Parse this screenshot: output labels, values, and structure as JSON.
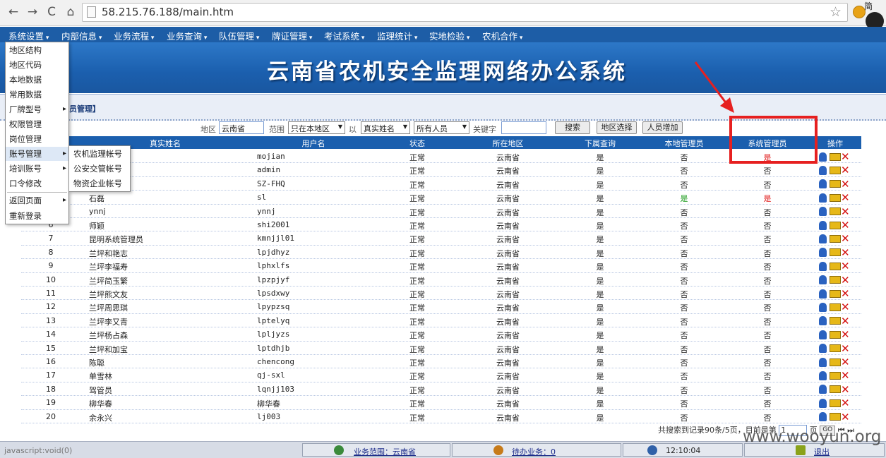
{
  "browser": {
    "url": "58.215.76.188/main.htm",
    "corner_text": "简"
  },
  "menubar": [
    "系统设置",
    "内部信息",
    "业务流程",
    "业务查询",
    "队伍管理",
    "牌证管理",
    "考试系统",
    "监理统计",
    "实地检验",
    "农机合作"
  ],
  "banner_title": "云南省农机安全监理网络办公系统",
  "breadcrumb": "员管理】",
  "filter": {
    "area_label": "地区",
    "area_value": "云南省",
    "scope_label": "范围",
    "scope_value": "只在本地区",
    "by_label": "以",
    "by_value": "真实姓名",
    "people_value": "所有人员",
    "keyword_label": "关键字",
    "search_button": "搜索",
    "area_select_button": "地区选择",
    "add_button": "人员增加"
  },
  "table": {
    "headers": [
      "真实姓名",
      "用户名",
      "状态",
      "所在地区",
      "下属查询",
      "本地管理员",
      "系统管理员",
      "操作"
    ],
    "rows": [
      {
        "no": "",
        "name": "",
        "user": "mojian",
        "status": "正常",
        "area": "云南省",
        "sub": "是",
        "local": "否",
        "sys": "是"
      },
      {
        "no": "",
        "name": "",
        "user": "admin",
        "status": "正常",
        "area": "云南省",
        "sub": "是",
        "local": "否",
        "sys": "否"
      },
      {
        "no": "",
        "name": "",
        "user": "SZ-FHQ",
        "status": "正常",
        "area": "云南省",
        "sub": "是",
        "local": "否",
        "sys": "否"
      },
      {
        "no": "",
        "name": "石磊",
        "user": "sl",
        "status": "正常",
        "area": "云南省",
        "sub": "是",
        "local": "是",
        "sys": "是"
      },
      {
        "no": "",
        "name": "ynnj",
        "user": "ynnj",
        "status": "正常",
        "area": "云南省",
        "sub": "是",
        "local": "否",
        "sys": "否"
      },
      {
        "no": "6",
        "name": "师颖",
        "user": "shi2001",
        "status": "正常",
        "area": "云南省",
        "sub": "是",
        "local": "否",
        "sys": "否"
      },
      {
        "no": "7",
        "name": "昆明系统管理员",
        "user": "kmnjjl01",
        "status": "正常",
        "area": "云南省",
        "sub": "是",
        "local": "否",
        "sys": "否"
      },
      {
        "no": "8",
        "name": "兰坪和艳志",
        "user": "lpjdhyz",
        "status": "正常",
        "area": "云南省",
        "sub": "是",
        "local": "否",
        "sys": "否"
      },
      {
        "no": "9",
        "name": "兰坪李福寿",
        "user": "lphxlfs",
        "status": "正常",
        "area": "云南省",
        "sub": "是",
        "local": "否",
        "sys": "否"
      },
      {
        "no": "10",
        "name": "兰坪简玉繁",
        "user": "lpzpjyf",
        "status": "正常",
        "area": "云南省",
        "sub": "是",
        "local": "否",
        "sys": "否"
      },
      {
        "no": "11",
        "name": "兰坪熊文友",
        "user": "lpsdxwy",
        "status": "正常",
        "area": "云南省",
        "sub": "是",
        "local": "否",
        "sys": "否"
      },
      {
        "no": "12",
        "name": "兰坪周思琪",
        "user": "lpypzsq",
        "status": "正常",
        "area": "云南省",
        "sub": "是",
        "local": "否",
        "sys": "否"
      },
      {
        "no": "13",
        "name": "兰坪李又青",
        "user": "lptelyq",
        "status": "正常",
        "area": "云南省",
        "sub": "是",
        "local": "否",
        "sys": "否"
      },
      {
        "no": "14",
        "name": "兰坪杨占森",
        "user": "lpljyzs",
        "status": "正常",
        "area": "云南省",
        "sub": "是",
        "local": "否",
        "sys": "否"
      },
      {
        "no": "15",
        "name": "兰坪和加宝",
        "user": "lptdhjb",
        "status": "正常",
        "area": "云南省",
        "sub": "是",
        "local": "否",
        "sys": "否"
      },
      {
        "no": "16",
        "name": "陈聪",
        "user": "chencong",
        "status": "正常",
        "area": "云南省",
        "sub": "是",
        "local": "否",
        "sys": "否"
      },
      {
        "no": "17",
        "name": "单雪林",
        "user": "qj-sxl",
        "status": "正常",
        "area": "云南省",
        "sub": "是",
        "local": "否",
        "sys": "否"
      },
      {
        "no": "18",
        "name": "驾管员",
        "user": "lqnjj103",
        "status": "正常",
        "area": "云南省",
        "sub": "是",
        "local": "否",
        "sys": "否"
      },
      {
        "no": "19",
        "name": "柳华春",
        "user": "柳华春",
        "status": "正常",
        "area": "云南省",
        "sub": "是",
        "local": "否",
        "sys": "否"
      },
      {
        "no": "20",
        "name": "余永兴",
        "user": "lj003",
        "status": "正常",
        "area": "云南省",
        "sub": "是",
        "local": "否",
        "sys": "否"
      }
    ]
  },
  "pager": {
    "summary": "共搜索到记录90条/5页，目前是第",
    "page_value": "1",
    "page_suffix": "页",
    "go": "GO",
    "nav": "⏮ ⏭"
  },
  "menu": {
    "items": [
      "地区结构",
      "地区代码",
      "本地数据",
      "常用数据",
      "厂牌型号",
      "权限管理",
      "岗位管理",
      "账号管理",
      "培训账号",
      "口令修改",
      "返回页面",
      "重新登录"
    ],
    "submenu": [
      "农机监理帐号",
      "公安交管帐号",
      "物资企业帐号"
    ]
  },
  "statusbar": {
    "left": "javascript:void(0)",
    "scope": "业务范围：云南省",
    "todo": "待办业务：0",
    "time": "12:10:04",
    "exit": "退出"
  },
  "watermark": "www.wooyun.org",
  "colors": {
    "header_blue": "#1b5fae",
    "annotation_red": "#e62020",
    "yes_red": "#e01818",
    "yes_green": "#1a9a1a"
  }
}
